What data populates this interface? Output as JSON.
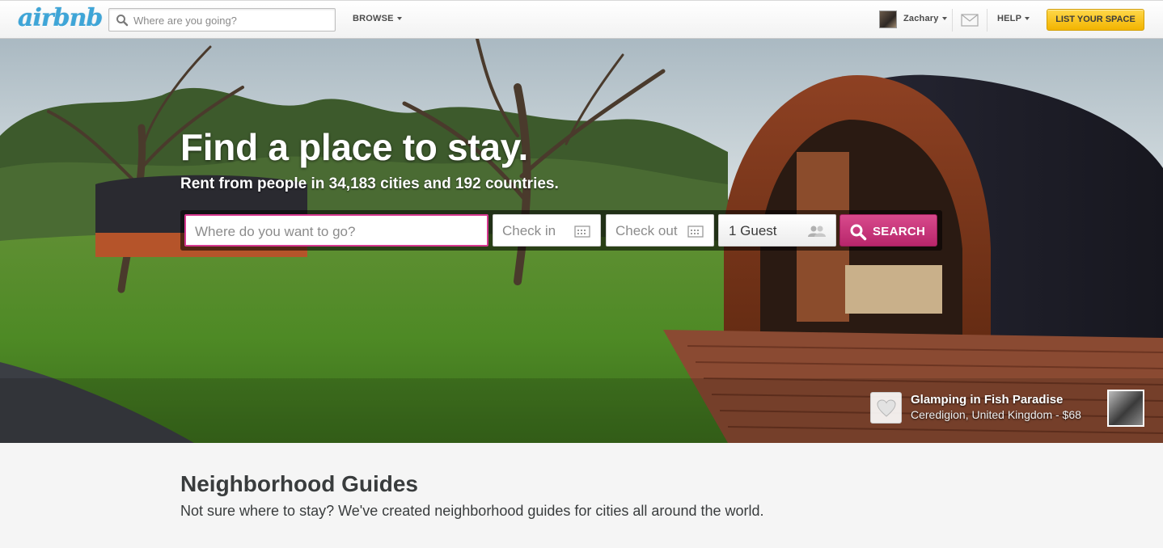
{
  "header": {
    "logo_text": "airbnb",
    "search_placeholder": "Where are you going?",
    "browse_label": "BROWSE",
    "user_name": "Zachary",
    "help_label": "HELP",
    "list_space_label": "LIST YOUR SPACE",
    "icons": [
      "search-icon",
      "envelope-icon",
      "caret-down-icon"
    ]
  },
  "hero": {
    "title": "Find a place to stay.",
    "subtitle": "Rent from people in 34,183 cities and 192 countries.",
    "search": {
      "where_placeholder": "Where do you want to go?",
      "checkin_placeholder": "Check in",
      "checkout_placeholder": "Check out",
      "guests_value": "1 Guest",
      "search_label": "SEARCH"
    },
    "featured": {
      "name": "Glamping in Fish Paradise",
      "location": "Ceredigion, United Kingdom - $68"
    }
  },
  "neighborhoods": {
    "title": "Neighborhood Guides",
    "description": "Not sure where to stay? We've created neighborhood guides for cities all around the world."
  },
  "colors": {
    "brand_blue": "#3ea5d7",
    "search_pink": "#c2306f",
    "list_button_yellow": "#f5c11d"
  }
}
